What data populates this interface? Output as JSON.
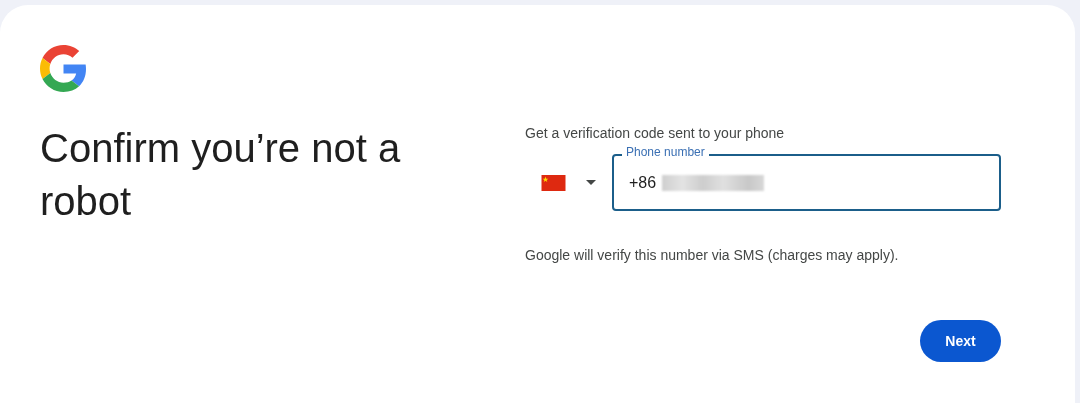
{
  "title": "Confirm you’re not a robot",
  "subtitle": "Get a verification code sent to your phone",
  "phone_field": {
    "label": "Phone number",
    "value": "+86",
    "focused": true
  },
  "helper_text": "Google will verify this number via SMS (charges may apply).",
  "buttons": [
    {
      "label": "Next",
      "kind": "primary"
    }
  ]
}
